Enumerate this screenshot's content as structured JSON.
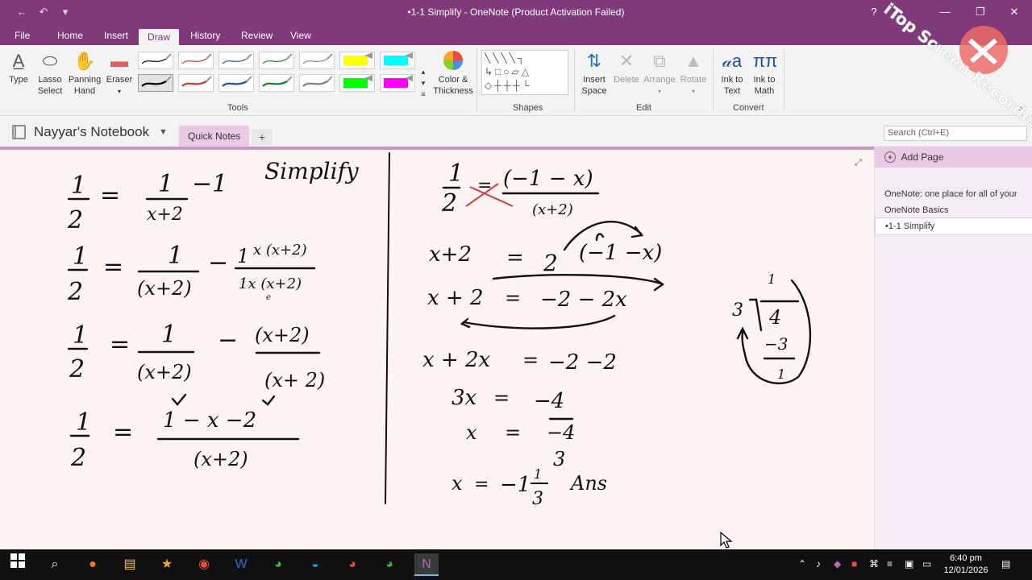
{
  "window": {
    "title": "•1-1 Simplify - OneNote (Product Activation Failed)",
    "qat": {
      "back_icon": "back-arrow-icon",
      "undo_icon": "undo-icon",
      "customize_icon": "qat-dropdown-icon"
    },
    "controls": {
      "help": "?",
      "minimize": "—",
      "restore": "❐",
      "close": "✕"
    }
  },
  "ribbon_tabs": [
    "File",
    "Home",
    "Insert",
    "Draw",
    "History",
    "Review",
    "View"
  ],
  "active_tab": "Draw",
  "ribbon": {
    "tools": {
      "label": "Tools",
      "type": "Type",
      "lasso": "Lasso Select",
      "lasso_line1": "Lasso",
      "lasso_line2": "Select",
      "panning_line1": "Panning",
      "panning_line2": "Hand",
      "eraser": "Eraser",
      "color_thickness_line1": "Color &",
      "color_thickness_line2": "Thickness",
      "pen_colors": [
        "#000000",
        "#c0392b",
        "#1f4e9c",
        "#1e7b34",
        "#7f7f7f",
        "#ffff00",
        "#00ffff",
        "#000000",
        "#c0392b",
        "#1f4e9c",
        "#1e7b34",
        "#7f7f7f",
        "#00ff00",
        "#ff00ff"
      ]
    },
    "shapes": {
      "label": "Shapes"
    },
    "edit": {
      "label": "Edit",
      "insert_space_line1": "Insert",
      "insert_space_line2": "Space",
      "delete": "Delete",
      "arrange": "Arrange",
      "rotate": "Rotate"
    },
    "convert": {
      "label": "Convert",
      "ink_to_text_line1": "Ink to",
      "ink_to_text_line2": "Text",
      "ink_to_math_line1": "Ink to",
      "ink_to_math_line2": "Math"
    }
  },
  "notebook": {
    "name": "Nayyar's Notebook",
    "section": "Quick Notes",
    "add_section": "+",
    "search_placeholder": "Search (Ctrl+E)"
  },
  "pages": {
    "add_page": "Add Page",
    "items": [
      {
        "line1": "OneNote: one place for all of your",
        "line2": "OneNote Basics"
      },
      {
        "line1": "•1-1 Simplify"
      }
    ]
  },
  "taskbar": {
    "time": "6:40 pm",
    "date": "12/01/2026",
    "apps": [
      "windows-start-icon",
      "search-icon",
      "firefox-icon",
      "file-explorer-icon",
      "trophy-app-icon",
      "screen-recorder-icon",
      "word-icon",
      "chrome-icon",
      "edge-icon",
      "chrome-profile-icon",
      "chrome-profile-2-icon",
      "onenote-icon"
    ]
  },
  "watermark": "iTop Screen Recorder",
  "ink_texts": {
    "simplify": "Simplify",
    "ans": "Ans"
  }
}
